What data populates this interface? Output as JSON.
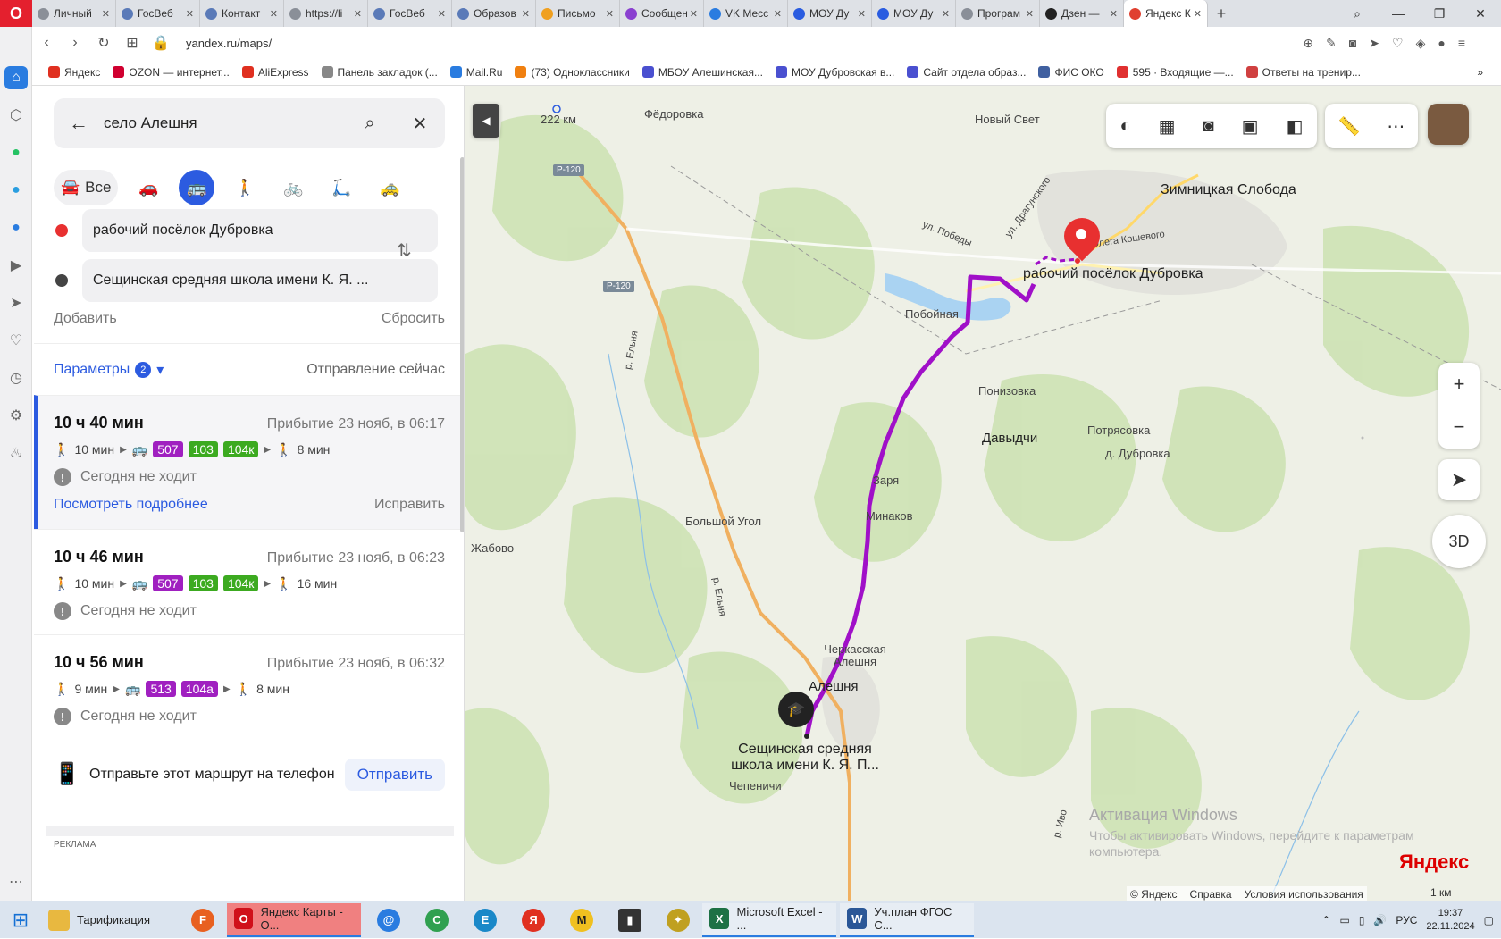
{
  "browser": {
    "tabs": [
      {
        "title": "Личный",
        "color": "#8a8f98"
      },
      {
        "title": "ГосВеб",
        "color": "#5a7ab8"
      },
      {
        "title": "Контакт",
        "color": "#5a7ab8"
      },
      {
        "title": "https://li",
        "color": "#8a8f98"
      },
      {
        "title": "ГосВеб",
        "color": "#5a7ab8"
      },
      {
        "title": "Образов",
        "color": "#5a7ab8"
      },
      {
        "title": "Письмо",
        "color": "#f0a020"
      },
      {
        "title": "Сообщен",
        "color": "#8a40d0"
      },
      {
        "title": "VK Месс",
        "color": "#2a7ce0"
      },
      {
        "title": "МОУ Ду",
        "color": "#2a5ce0"
      },
      {
        "title": "МОУ Ду",
        "color": "#2a5ce0"
      },
      {
        "title": "Програм",
        "color": "#8a8f98"
      },
      {
        "title": "Дзен —",
        "color": "#222222"
      },
      {
        "title": "Яндекс К",
        "color": "#e04030"
      }
    ],
    "url": "yandex.ru/maps/",
    "bookmarks": [
      "Яндекс",
      "OZON — интернет...",
      "AliExpress",
      "Панель закладок (...",
      "Mail.Ru",
      "(73) Одноклассники",
      "МБОУ Алешинская...",
      "МОУ Дубровская в...",
      "Сайт отдела образ...",
      "ФИС ОКО",
      "595 · Входящие —...",
      "Ответы на тренир..."
    ]
  },
  "panel": {
    "search_value": "село Алешня",
    "mode_all": "Все",
    "from": "рабочий посёлок Дубровка",
    "to": "Сещинская средняя школа имени К. Я. ...",
    "add": "Добавить",
    "reset": "Сбросить",
    "params": "Параметры",
    "params_count": "2",
    "departure": "Отправление сейчас",
    "routes": [
      {
        "duration": "10 ч 40 мин",
        "arrival": "Прибытие 23 нояб, в 06:17",
        "walk1": "10 мин",
        "buses": [
          "507",
          "103",
          "104к"
        ],
        "walk2": "8 мин",
        "note": "Сегодня не ходит",
        "details": "Посмотреть подробнее",
        "fix": "Исправить"
      },
      {
        "duration": "10 ч 46 мин",
        "arrival": "Прибытие 23 нояб, в 06:23",
        "walk1": "10 мин",
        "buses": [
          "507",
          "103",
          "104к"
        ],
        "walk2": "16 мин",
        "note": "Сегодня не ходит"
      },
      {
        "duration": "10 ч 56 мин",
        "arrival": "Прибытие 23 нояб, в 06:32",
        "walk1": "9 мин",
        "buses": [
          "513",
          "104а"
        ],
        "walk2": "8 мин",
        "note": "Сегодня не ходит"
      }
    ],
    "send_text": "Отправьте этот маршрут на телефон",
    "send_button": "Отправить",
    "ad_label": "РЕКЛАМА"
  },
  "map": {
    "labels": {
      "km": "222 км",
      "fedorovka": "Фёдоровка",
      "novy_svet": "Новый Свет",
      "zimnitskaya": "Зимницкая Слобода",
      "dragunskogo": "ул. Драгунского",
      "pobedy": "ул. Победы",
      "koshevogo": "Олега Кошевого",
      "dubrovka": "рабочий посёлок Дубровка",
      "poboynaya": "Побойная",
      "ponizovka": "Понизовка",
      "davydchi": "Давыдчи",
      "potryasovka": "Потрясовка",
      "d_dubrovka": "д. Дубровка",
      "zarya": "Заря",
      "minakov": "Минаков",
      "bolshoy_ugol": "Большой Угол",
      "zhabovo": "Жабово",
      "cherkasskaya": "Черкасская Алешня",
      "aleshnya": "Алешня",
      "school": "Сещинская средняя школа имени К. Я. П...",
      "chepenichi": "Чепеничи",
      "elnya1": "р. Ельня",
      "elnya2": "р. Ельня",
      "r120a": "Р-120",
      "r120b": "Р-120",
      "ivo": "р. Иво"
    },
    "zoom_in": "+",
    "zoom_out": "−",
    "three_d": "3D",
    "brand": "Яндекс",
    "footer": [
      "© Яндекс",
      "Справка",
      "Условия использования"
    ],
    "scale": "1 км",
    "watermark_title": "Активация Windows",
    "watermark_text": "Чтобы активировать Windows, перейдите к параметрам компьютера.",
    "route_color": "#a010c8"
  },
  "taskbar": {
    "items": [
      "Тарификация",
      "Яндекс Карты - О...",
      "Microsoft Excel - ...",
      "Уч.план ФГОС С..."
    ],
    "lang": "РУС",
    "time": "19:37",
    "date": "22.11.2024"
  }
}
